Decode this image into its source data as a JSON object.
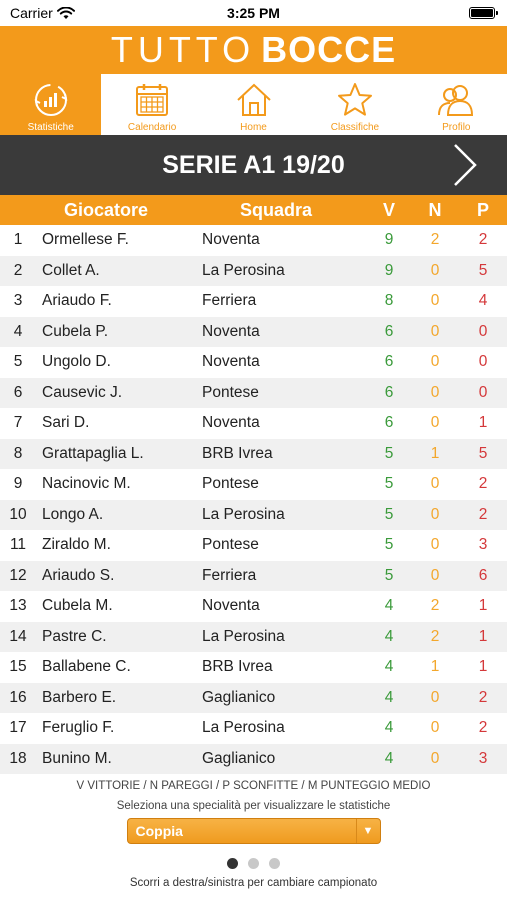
{
  "status_bar": {
    "carrier": "Carrier",
    "time": "3:25 PM"
  },
  "header": {
    "title_light": "TUTTO",
    "title_bold": "BOCCE",
    "brand_color": "#f39a1b"
  },
  "tabs": [
    {
      "label": "Statistiche",
      "icon": "stats-icon",
      "active": true
    },
    {
      "label": "Calendario",
      "icon": "calendar-icon",
      "active": false
    },
    {
      "label": "Home",
      "icon": "home-icon",
      "active": false
    },
    {
      "label": "Classifiche",
      "icon": "star-icon",
      "active": false
    },
    {
      "label": "Profilo",
      "icon": "profile-icon",
      "active": false
    }
  ],
  "section": {
    "title": "SERIE A1 19/20",
    "next_icon": "chevron-right-icon"
  },
  "table": {
    "headers": {
      "player": "Giocatore",
      "team": "Squadra",
      "v": "V",
      "n": "N",
      "p": "P"
    },
    "rows": [
      {
        "rank": "1",
        "player": "Ormellese F.",
        "team": "Noventa",
        "v": "9",
        "n": "2",
        "p": "2"
      },
      {
        "rank": "2",
        "player": "Collet A.",
        "team": "La Perosina",
        "v": "9",
        "n": "0",
        "p": "5"
      },
      {
        "rank": "3",
        "player": "Ariaudo F.",
        "team": "Ferriera",
        "v": "8",
        "n": "0",
        "p": "4"
      },
      {
        "rank": "4",
        "player": "Cubela P.",
        "team": "Noventa",
        "v": "6",
        "n": "0",
        "p": "0"
      },
      {
        "rank": "5",
        "player": "Ungolo D.",
        "team": "Noventa",
        "v": "6",
        "n": "0",
        "p": "0"
      },
      {
        "rank": "6",
        "player": "Causevic J.",
        "team": "Pontese",
        "v": "6",
        "n": "0",
        "p": "0"
      },
      {
        "rank": "7",
        "player": "Sari D.",
        "team": "Noventa",
        "v": "6",
        "n": "0",
        "p": "1"
      },
      {
        "rank": "8",
        "player": "Grattapaglia L.",
        "team": "BRB Ivrea",
        "v": "5",
        "n": "1",
        "p": "5"
      },
      {
        "rank": "9",
        "player": "Nacinovic M.",
        "team": "Pontese",
        "v": "5",
        "n": "0",
        "p": "2"
      },
      {
        "rank": "10",
        "player": "Longo A.",
        "team": "La Perosina",
        "v": "5",
        "n": "0",
        "p": "2"
      },
      {
        "rank": "11",
        "player": "Ziraldo M.",
        "team": "Pontese",
        "v": "5",
        "n": "0",
        "p": "3"
      },
      {
        "rank": "12",
        "player": "Ariaudo S.",
        "team": "Ferriera",
        "v": "5",
        "n": "0",
        "p": "6"
      },
      {
        "rank": "13",
        "player": "Cubela M.",
        "team": "Noventa",
        "v": "4",
        "n": "2",
        "p": "1"
      },
      {
        "rank": "14",
        "player": "Pastre C.",
        "team": "La Perosina",
        "v": "4",
        "n": "2",
        "p": "1"
      },
      {
        "rank": "15",
        "player": "Ballabene C.",
        "team": "BRB Ivrea",
        "v": "4",
        "n": "1",
        "p": "1"
      },
      {
        "rank": "16",
        "player": "Barbero E.",
        "team": "Gaglianico",
        "v": "4",
        "n": "0",
        "p": "2"
      },
      {
        "rank": "17",
        "player": "Feruglio F.",
        "team": "La Perosina",
        "v": "4",
        "n": "0",
        "p": "2"
      },
      {
        "rank": "18",
        "player": "Bunino M.",
        "team": "Gaglianico",
        "v": "4",
        "n": "0",
        "p": "3"
      }
    ]
  },
  "legend": "V VITTORIE / N PAREGGI / P SCONFITTE / M PUNTEGGIO MEDIO",
  "speciality_hint": "Seleziona una specialità per visualizzare le statistiche",
  "speciality_select": {
    "value": "Coppia"
  },
  "pager": {
    "count": 3,
    "active": 0
  },
  "scroll_hint": "Scorri a destra/sinistra per cambiare campionato"
}
